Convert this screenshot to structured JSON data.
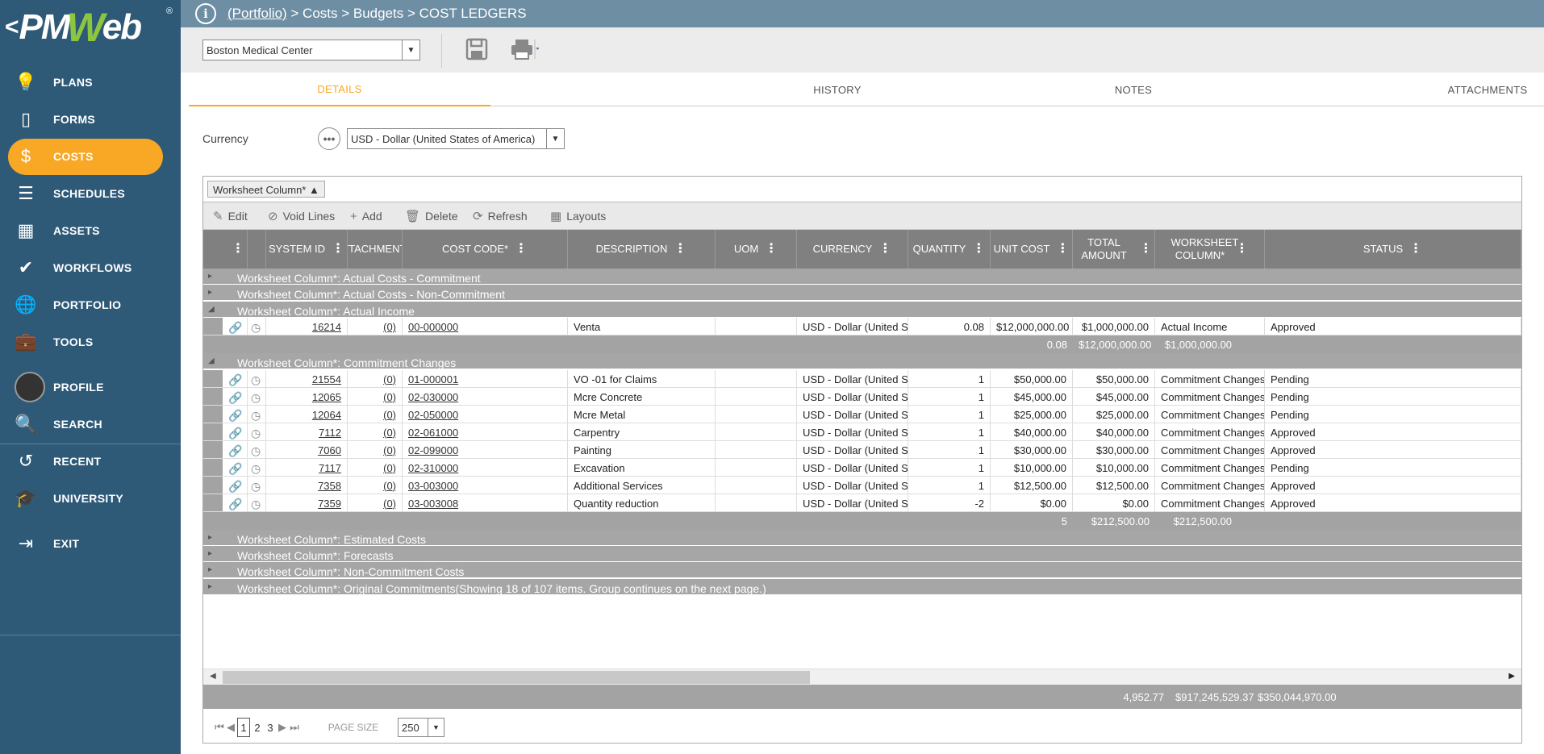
{
  "logo": {
    "back": "<",
    "pm": "PM",
    "w": "W",
    "eb": "eb",
    "reg": "®"
  },
  "nav": [
    {
      "id": "plans",
      "label": "PLANS",
      "icon": "lightbulb-icon"
    },
    {
      "id": "forms",
      "label": "FORMS",
      "icon": "document-icon"
    },
    {
      "id": "costs",
      "label": "COSTS",
      "icon": "dollar-icon"
    },
    {
      "id": "schedules",
      "label": "SCHEDULES",
      "icon": "gantt-icon"
    },
    {
      "id": "assets",
      "label": "ASSETS",
      "icon": "building-icon"
    },
    {
      "id": "workflows",
      "label": "WORKFLOWS",
      "icon": "check-icon"
    },
    {
      "id": "portfolio",
      "label": "PORTFOLIO",
      "icon": "globe-icon"
    },
    {
      "id": "tools",
      "label": "TOOLS",
      "icon": "toolbox-icon"
    },
    {
      "id": "profile",
      "label": "PROFILE",
      "icon": "avatar"
    },
    {
      "id": "search",
      "label": "SEARCH",
      "icon": "search-icon"
    },
    {
      "id": "recent",
      "label": "RECENT",
      "icon": "history-icon"
    },
    {
      "id": "university",
      "label": "UNIVERSITY",
      "icon": "graduation-cap-icon"
    },
    {
      "id": "exit",
      "label": "EXIT",
      "icon": "exit-icon"
    }
  ],
  "active_nav": "COSTS",
  "breadcrumb": {
    "portfolio": "(Portfolio)",
    "rest": " > Costs > Budgets > COST LEDGERS"
  },
  "toolbar": {
    "project": "Boston Medical Center"
  },
  "tabs": [
    "DETAILS",
    "HISTORY",
    "NOTES",
    "ATTACHMENTS"
  ],
  "currency": {
    "label": "Currency",
    "value": "USD - Dollar (United States of America)"
  },
  "grid": {
    "group_chip": "Worksheet Column* ▲",
    "actions": [
      {
        "label": "Edit",
        "icon": "✎"
      },
      {
        "label": "Void Lines",
        "icon": "⊘"
      },
      {
        "label": "Add",
        "icon": "+"
      },
      {
        "label": "Delete",
        "icon": "🗑"
      },
      {
        "label": "Refresh",
        "icon": "⟳"
      },
      {
        "label": "Layouts",
        "icon": "▦"
      }
    ],
    "headers": [
      "SYSTEM ID",
      "ATTACHMENTS",
      "COST CODE*",
      "DESCRIPTION",
      "UOM",
      "CURRENCY",
      "QUANTITY",
      "UNIT COST",
      "TOTAL AMOUNT",
      "WORKSHEET COLUMN*",
      "STATUS"
    ],
    "groups_top": [
      "Worksheet Column*: Actual Costs - Commitment",
      "Worksheet Column*: Actual Costs - Non-Commitment",
      "Worksheet Column*: Actual Income"
    ],
    "income_rows": [
      {
        "id": "16214",
        "att": "(0)",
        "code": "00-000000",
        "desc": "Venta",
        "uom": "",
        "cur": "USD - Dollar (United States of America)",
        "qty": "0.08",
        "unit": "$12,000,000.00",
        "total": "$1,000,000.00",
        "ws": "Actual Income",
        "status": "Approved"
      }
    ],
    "income_sum": {
      "qty": "0.08",
      "unit": "$12,000,000.00",
      "total": "$1,000,000.00"
    },
    "group_changes": "Worksheet Column*: Commitment Changes",
    "change_rows": [
      {
        "id": "21554",
        "att": "(0)",
        "code": "01-000001",
        "desc": "VO -01 for Claims",
        "uom": "",
        "cur": "USD - Dollar (United States of America)",
        "qty": "1",
        "unit": "$50,000.00",
        "total": "$50,000.00",
        "ws": "Commitment Changes",
        "status": "Pending"
      },
      {
        "id": "12065",
        "att": "(0)",
        "code": "02-030000",
        "desc": "Mcre Concrete",
        "uom": "",
        "cur": "USD - Dollar (United States of America)",
        "qty": "1",
        "unit": "$45,000.00",
        "total": "$45,000.00",
        "ws": "Commitment Changes",
        "status": "Pending"
      },
      {
        "id": "12064",
        "att": "(0)",
        "code": "02-050000",
        "desc": "Mcre Metal",
        "uom": "",
        "cur": "USD - Dollar (United States of America)",
        "qty": "1",
        "unit": "$25,000.00",
        "total": "$25,000.00",
        "ws": "Commitment Changes",
        "status": "Pending"
      },
      {
        "id": "7112",
        "att": "(0)",
        "code": "02-061000",
        "desc": "Carpentry",
        "uom": "",
        "cur": "USD - Dollar (United States of America)",
        "qty": "1",
        "unit": "$40,000.00",
        "total": "$40,000.00",
        "ws": "Commitment Changes",
        "status": "Approved"
      },
      {
        "id": "7060",
        "att": "(0)",
        "code": "02-099000",
        "desc": "Painting",
        "uom": "",
        "cur": "USD - Dollar (United States of America)",
        "qty": "1",
        "unit": "$30,000.00",
        "total": "$30,000.00",
        "ws": "Commitment Changes",
        "status": "Approved"
      },
      {
        "id": "7117",
        "att": "(0)",
        "code": "02-310000",
        "desc": "Excavation",
        "uom": "",
        "cur": "USD - Dollar (United States of America)",
        "qty": "1",
        "unit": "$10,000.00",
        "total": "$10,000.00",
        "ws": "Commitment Changes",
        "status": "Pending"
      },
      {
        "id": "7358",
        "att": "(0)",
        "code": "03-003000",
        "desc": "Additional Services",
        "uom": "",
        "cur": "USD - Dollar (United States of America)",
        "qty": "1",
        "unit": "$12,500.00",
        "total": "$12,500.00",
        "ws": "Commitment Changes",
        "status": "Approved"
      },
      {
        "id": "7359",
        "att": "(0)",
        "code": "03-003008",
        "desc": "Quantity reduction",
        "uom": "",
        "cur": "USD - Dollar (United States of America)",
        "qty": "-2",
        "unit": "$0.00",
        "total": "$0.00",
        "ws": "Commitment Changes",
        "status": "Approved"
      }
    ],
    "changes_sum": {
      "qty": "5",
      "unit": "$212,500.00",
      "total": "$212,500.00"
    },
    "groups_bottom": [
      "Worksheet Column*: Estimated Costs",
      "Worksheet Column*: Forecasts",
      "Worksheet Column*: Non-Commitment Costs",
      "Worksheet Column*: Original Commitments(Showing 18 of 107 items. Group continues on the next page.)"
    ],
    "grand": {
      "qty": "4,952.77",
      "unit": "$917,245,529.37",
      "total": "$350,044,970.00"
    },
    "pager": {
      "pages": [
        "1",
        "2",
        "3"
      ],
      "current": "1",
      "size_label": "PAGE SIZE",
      "size": "250"
    }
  }
}
